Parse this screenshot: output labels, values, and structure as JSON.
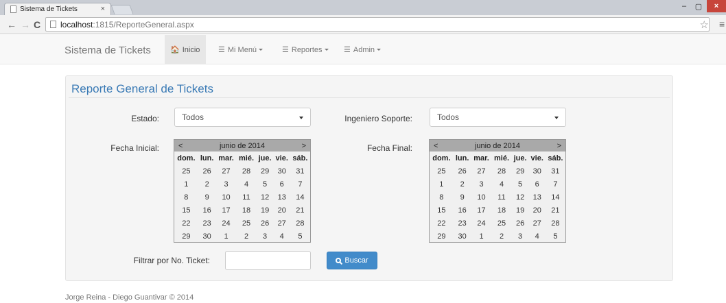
{
  "browser": {
    "tab_title": "Sistema de Tickets",
    "tab_close": "×",
    "url_host": "localhost",
    "url_path": ":1815/ReporteGeneral.aspx",
    "min_glyph": "–",
    "max_glyph": "▢",
    "close_glyph": "×",
    "back_glyph": "←",
    "forward_glyph": "→",
    "reload_glyph": "C",
    "star_glyph": "☆",
    "menu_glyph": "≡"
  },
  "navbar": {
    "brand": "Sistema de Tickets",
    "items": [
      {
        "label": "Inicio",
        "icon": "home-icon",
        "glyph": "🏠",
        "active": true
      },
      {
        "label": "Mi Menú",
        "icon": "list-icon",
        "glyph": "☰",
        "dropdown": true
      },
      {
        "label": "Reportes",
        "icon": "list-icon",
        "glyph": "☰",
        "dropdown": true
      },
      {
        "label": "Admin",
        "icon": "list-icon",
        "glyph": "☰",
        "dropdown": true
      }
    ]
  },
  "report": {
    "title": "Reporte General de Tickets",
    "estado_label": "Estado:",
    "estado_value": "Todos",
    "ingeniero_label": "Ingeniero Soporte:",
    "ingeniero_value": "Todos",
    "fecha_inicial_label": "Fecha Inicial:",
    "fecha_final_label": "Fecha Final:",
    "filter_label": "Filtrar por No. Ticket:",
    "filter_value": "",
    "search_button": "Buscar"
  },
  "calendar": {
    "month": "junio de 2014",
    "prev": "<",
    "next": ">",
    "days": [
      "dom.",
      "lun.",
      "mar.",
      "mié.",
      "jue.",
      "vie.",
      "sáb."
    ],
    "weeks": [
      [
        "25",
        "26",
        "27",
        "28",
        "29",
        "30",
        "31"
      ],
      [
        "1",
        "2",
        "3",
        "4",
        "5",
        "6",
        "7"
      ],
      [
        "8",
        "9",
        "10",
        "11",
        "12",
        "13",
        "14"
      ],
      [
        "15",
        "16",
        "17",
        "18",
        "19",
        "20",
        "21"
      ],
      [
        "22",
        "23",
        "24",
        "25",
        "26",
        "27",
        "28"
      ],
      [
        "29",
        "30",
        "1",
        "2",
        "3",
        "4",
        "5"
      ]
    ]
  },
  "footer": "Jorge Reina - Diego Guantivar © 2014",
  "colors": {
    "accent": "#428bca",
    "title": "#3a7ab5",
    "calendar_header": "#a9a9a9"
  }
}
